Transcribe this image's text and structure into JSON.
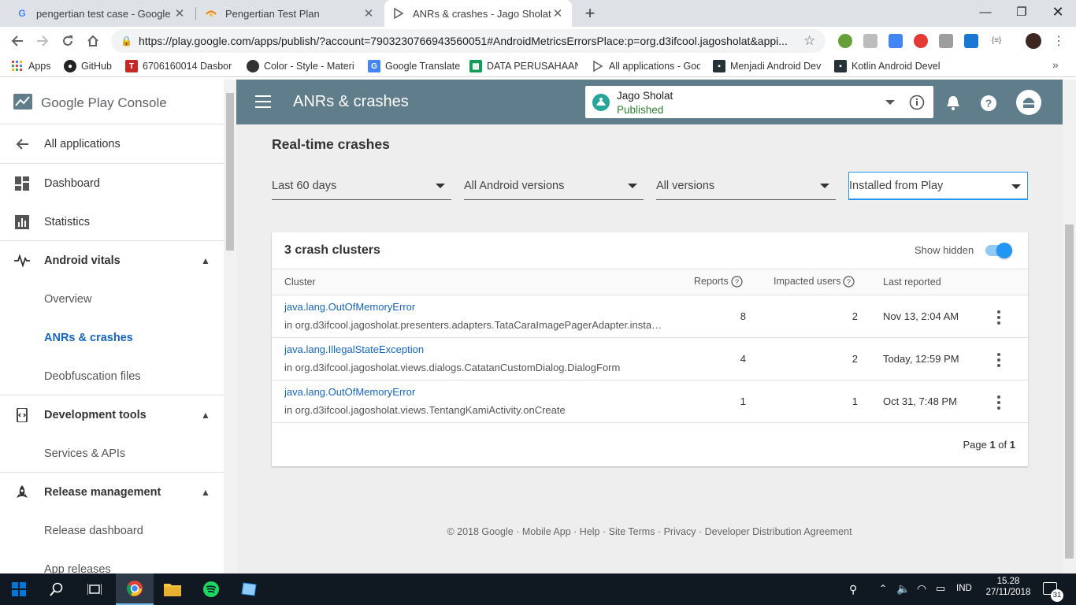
{
  "browser": {
    "tabs": [
      {
        "title": "pengertian test case - Google Se",
        "favicon": "G"
      },
      {
        "title": "Pengertian Test Plan",
        "favicon": "blogger-icon"
      },
      {
        "title": "ANRs & crashes - Jago Sholat - G",
        "favicon": "play-console-icon"
      }
    ],
    "url": "https://play.google.com/apps/publish/?account=7903230766943560051#AndroidMetricsErrorsPlace:p=org.d3ifcool.jagosholat&appi...",
    "bookmarks": [
      "Apps",
      "GitHub",
      "6706160014 Dasbor",
      "Color - Style - Materi",
      "Google Translate",
      "DATA PERUSAHAAN",
      "All applications - Goo",
      "Menjadi Android Dev",
      "Kotlin Android Devel"
    ]
  },
  "sidebar": {
    "logo": "Google Play Console",
    "back": "All applications",
    "items": {
      "dashboard": "Dashboard",
      "statistics": "Statistics",
      "android_vitals": "Android vitals",
      "overview": "Overview",
      "anrs": "ANRs & crashes",
      "deobfuscation": "Deobfuscation files",
      "dev_tools": "Development tools",
      "services": "Services & APIs",
      "release_mgmt": "Release management",
      "release_dashboard": "Release dashboard",
      "app_releases": "App releases"
    }
  },
  "header": {
    "title": "ANRs & crashes",
    "app_name": "Jago Sholat",
    "app_status": "Published"
  },
  "main": {
    "section_title": "Real-time crashes",
    "filters": [
      "Last 60 days",
      "All Android versions",
      "All versions",
      "Installed from Play"
    ],
    "card": {
      "title": "3 crash clusters",
      "show_hidden": "Show hidden",
      "show_hidden_on": true,
      "columns": {
        "cluster": "Cluster",
        "reports": "Reports",
        "impacted": "Impacted users",
        "last": "Last reported"
      },
      "rows": [
        {
          "error": "java.lang.OutOfMemoryError",
          "location": "in org.d3ifcool.jagosholat.presenters.adapters.TataCaraImagePagerAdapter.insta…",
          "reports": "8",
          "users": "2",
          "last": "Nov 13, 2:04 AM"
        },
        {
          "error": "java.lang.IllegalStateException",
          "location": "in org.d3ifcool.jagosholat.views.dialogs.CatatanCustomDialog.DialogForm",
          "reports": "4",
          "users": "2",
          "last": "Today, 12:59 PM"
        },
        {
          "error": "java.lang.OutOfMemoryError",
          "location": "in org.d3ifcool.jagosholat.views.TentangKamiActivity.onCreate",
          "reports": "1",
          "users": "1",
          "last": "Oct 31, 7:48 PM"
        }
      ],
      "pagination": {
        "prefix": "Page ",
        "current": "1",
        "of": " of ",
        "total": "1"
      }
    },
    "footer": [
      "© 2018 Google",
      "Mobile App",
      "Help",
      "Site Terms",
      "Privacy",
      "Developer Distribution Agreement"
    ]
  },
  "taskbar": {
    "language": "IND",
    "time": "15.28",
    "date": "27/11/2018",
    "notifications": "31"
  },
  "colors": {
    "header": "#607d8b",
    "link": "#1565c0",
    "toggle": "#2196f3",
    "taskbar": "#101822"
  }
}
